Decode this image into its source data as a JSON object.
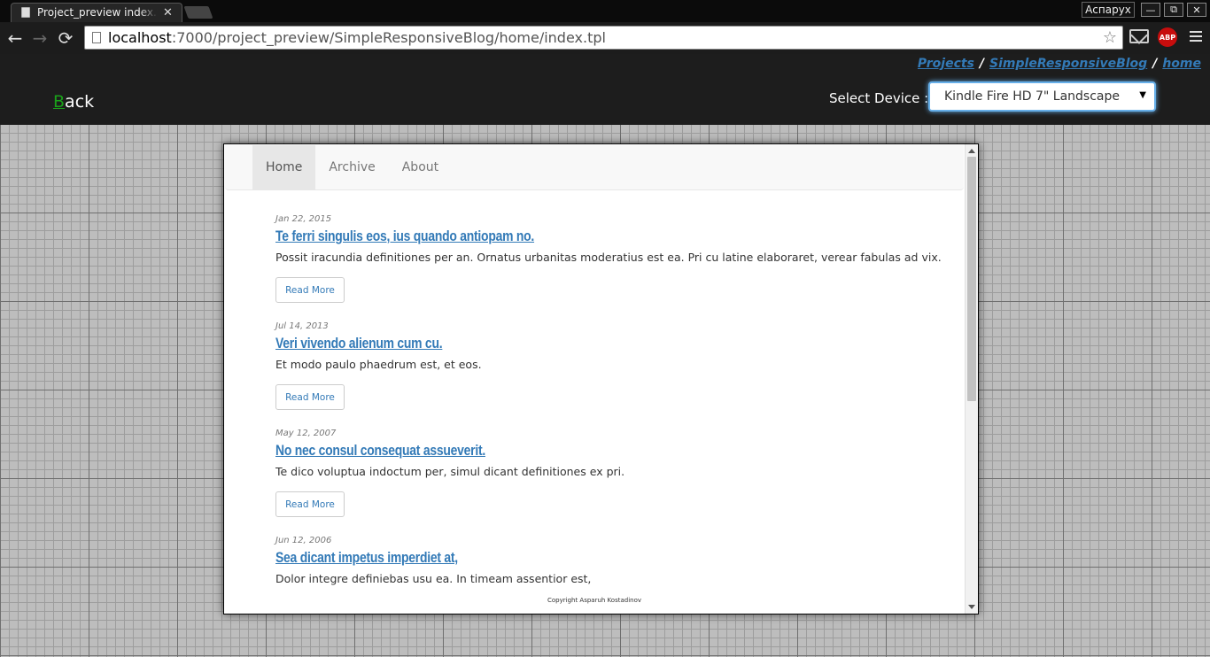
{
  "browser": {
    "tab_title": "Project_preview index.tpl",
    "profile_name": "Аспарух",
    "url_host": "localhost",
    "url_rest": ":7000/project_preview/SimpleResponsiveBlog/home/index.tpl",
    "extensions": {
      "abp_label": "ABP"
    },
    "window_controls": {
      "minimize": "—",
      "restore": "⧉",
      "close": "✕"
    }
  },
  "header": {
    "breadcrumb": [
      "Projects",
      "SimpleResponsiveBlog",
      "home"
    ],
    "separator": "/",
    "back_first_letter": "B",
    "back_rest": "ack",
    "device_label": "Select Device :",
    "device_selected": "Kindle Fire HD 7\" Landscape"
  },
  "blog": {
    "nav": [
      "Home",
      "Archive",
      "About"
    ],
    "active_nav": "Home",
    "read_more_label": "Read More",
    "posts": [
      {
        "date": "Jan 22, 2015",
        "title": "Te ferri singulis eos, ius quando antiopam no.",
        "excerpt": "Possit iracundia definitiones per an. Ornatus urbanitas moderatius est ea. Pri cu latine elaboraret, verear fabulas ad vix."
      },
      {
        "date": "Jul 14, 2013",
        "title": "Veri vivendo alienum cum cu.",
        "excerpt": "Et modo paulo phaedrum est, et eos."
      },
      {
        "date": "May 12, 2007",
        "title": "No nec consul consequat assueverit.",
        "excerpt": "Te dico voluptua indoctum per, simul dicant definitiones ex pri."
      },
      {
        "date": "Jun 12, 2006",
        "title": "Sea dicant impetus imperdiet at,",
        "excerpt": "Dolor integre definiebas usu ea. In timeam assentior est,"
      }
    ],
    "copyright": "Copyright Asparuh Kostadinov"
  }
}
